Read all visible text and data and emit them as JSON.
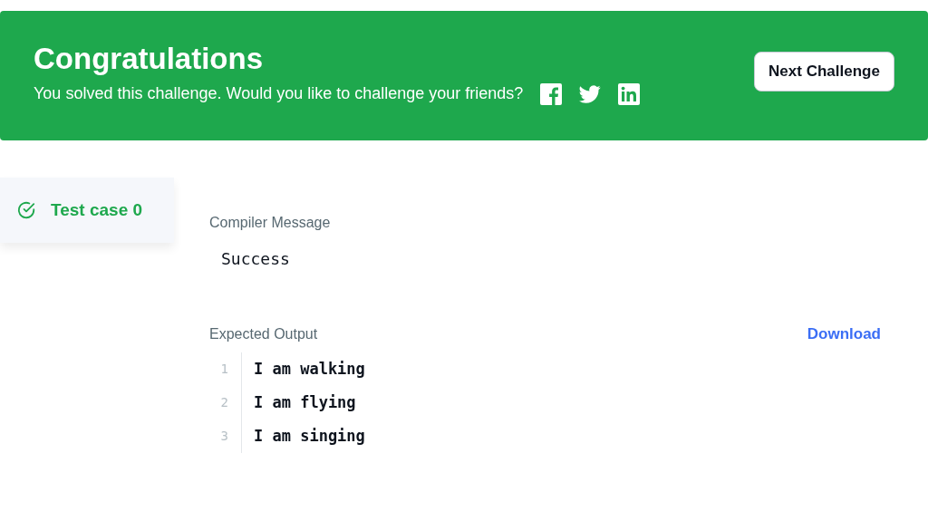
{
  "banner": {
    "title": "Congratulations",
    "message": "You solved this challenge. Would you like to challenge your friends?",
    "share": [
      {
        "kind": "facebook"
      },
      {
        "kind": "twitter"
      },
      {
        "kind": "linkedin"
      }
    ],
    "button": "Next Challenge"
  },
  "test_cases": [
    {
      "label": "Test case 0",
      "selected": true,
      "passed": true
    }
  ],
  "compiler_message": {
    "label": "Compiler Message",
    "text": "Success"
  },
  "expected_output": {
    "label": "Expected Output",
    "download": "Download",
    "lines": [
      {
        "number": "1",
        "text": "I am walking"
      },
      {
        "number": "2",
        "text": "I am flying"
      },
      {
        "number": "3",
        "text": "I am singing"
      }
    ]
  }
}
